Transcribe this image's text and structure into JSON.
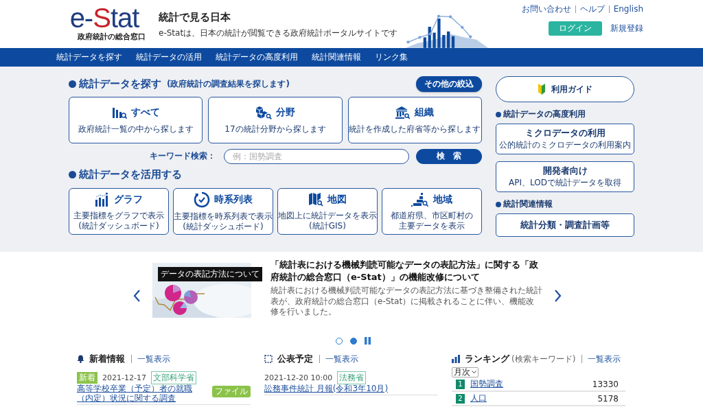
{
  "header": {
    "logo": {
      "prefix": "e-",
      "highlight": "S",
      "suffix": "tat",
      "subtitle": "政府統計の総合窓口"
    },
    "title": "統計で見る日本",
    "tagline": "e-Statは、日本の統計が閲覧できる政府統計ポータルサイトです",
    "top_links": [
      "お問い合わせ",
      "ヘルプ",
      "English"
    ],
    "login_button": "ログイン",
    "register_link": "新規登録"
  },
  "nav": [
    "統計データを探す",
    "統計データの活用",
    "統計データの高度利用",
    "統計関連情報",
    "リンク集"
  ],
  "search_section": {
    "heading": "統計データを探す",
    "subheading": "(政府統計の調査結果を探します)",
    "filter_button": "その他の絞込",
    "cards": [
      {
        "kind": "all",
        "title": "すべて",
        "desc": "政府統計一覧の中から探します"
      },
      {
        "kind": "field",
        "title": "分野",
        "desc": "17の統計分野から探します"
      },
      {
        "kind": "org",
        "title": "組織",
        "desc": "統計を作成した府省等から探します"
      }
    ],
    "keyword_label": "キーワード検索：",
    "keyword_placeholder": "例：国勢調査",
    "search_button": "検　索"
  },
  "use_section": {
    "heading": "統計データを活用する",
    "cards": [
      {
        "kind": "graph",
        "title": "グラフ",
        "desc": [
          "主要指標をグラフで表示",
          "(統計ダッシュボード)"
        ]
      },
      {
        "kind": "timeseries",
        "title": "時系列表",
        "desc": [
          "主要指標を時系列表で表示",
          "(統計ダッシュボード)"
        ]
      },
      {
        "kind": "map",
        "title": "地図",
        "desc": [
          "地図上に統計データを表示",
          "(統計GIS)"
        ]
      },
      {
        "kind": "region",
        "title": "地域",
        "desc": [
          "都道府県、市区町村の",
          "主要データを表示"
        ]
      }
    ]
  },
  "sidebar": {
    "guide_button": "利用ガイド",
    "groups": [
      {
        "heading": "統計データの高度利用",
        "items": [
          {
            "title": "ミクロデータの利用",
            "desc": "公的統計のミクロデータの利用案内"
          },
          {
            "title": "開発者向け",
            "desc": "API、LODで統計データを取得"
          }
        ]
      },
      {
        "heading": "統計関連情報",
        "items": [
          {
            "title": "統計分類・調査計画等"
          }
        ]
      }
    ]
  },
  "carousel": {
    "banner_label": "データの表記方法について",
    "headline": "「統計表における機械判読可能なデータの表記方法」に関する「政府統計の総合窓口（e-Stat）」の機能改修について",
    "summary": "統計表における機械判読可能なデータの表記方法に基づき整備された統計表が、政府統計の総合窓口（e-Stat）に掲載されることに伴い、機能改修を行いました。",
    "dots": [
      {
        "selected": false
      },
      {
        "selected": true
      }
    ]
  },
  "news": {
    "heading": "新着情報",
    "list_link": "一覧表示",
    "items": [
      {
        "badge": "新着",
        "date": "2021-12-17",
        "agency": "文部科学省",
        "title": "高等学校卒業（予定）者の就職（内定）状況に関する調査",
        "tag": "ファイル"
      }
    ]
  },
  "schedule": {
    "heading": "公表予定",
    "list_link": "一覧表示",
    "items": [
      {
        "date": "2021-12-20 10:00",
        "agency": "法務省",
        "title": "訟務事件統計 月報(令和3年10月)"
      }
    ]
  },
  "ranking": {
    "heading": "ランキング",
    "note": "(検索キーワード)",
    "list_link": "一覧表示",
    "period": "月次",
    "items": [
      {
        "rank": "1",
        "term": "国勢調査",
        "count": "13330"
      },
      {
        "rank": "2",
        "term": "人口",
        "count": "5178"
      }
    ]
  }
}
